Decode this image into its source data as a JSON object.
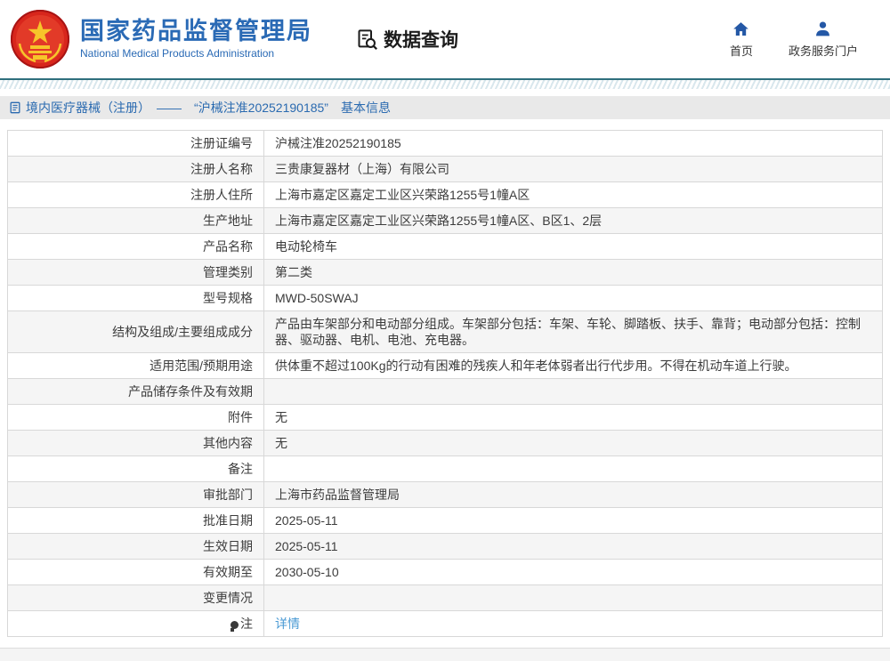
{
  "header": {
    "site_title": "国家药品监督管理局",
    "site_subtitle": "National Medical Products Administration",
    "section_title": "数据查询",
    "nav": [
      {
        "label": "首页",
        "icon": "home-icon"
      },
      {
        "label": "政务服务门户",
        "icon": "user-icon"
      }
    ]
  },
  "breadcrumb": {
    "text": "境内医疗器械（注册）　——　“沪械注准20252190185”　基本信息"
  },
  "table": {
    "rows": [
      {
        "label": "注册证编号",
        "value": "沪械注准20252190185"
      },
      {
        "label": "注册人名称",
        "value": "三贵康复器材（上海）有限公司"
      },
      {
        "label": "注册人住所",
        "value": "上海市嘉定区嘉定工业区兴荣路1255号1幢A区"
      },
      {
        "label": "生产地址",
        "value": "上海市嘉定区嘉定工业区兴荣路1255号1幢A区、B区1、2层"
      },
      {
        "label": "产品名称",
        "value": "电动轮椅车"
      },
      {
        "label": "管理类别",
        "value": "第二类"
      },
      {
        "label": "型号规格",
        "value": "MWD-50SWAJ"
      },
      {
        "label": "结构及组成/主要组成成分",
        "value": "产品由车架部分和电动部分组成。车架部分包括：车架、车轮、脚踏板、扶手、靠背；电动部分包括：控制器、驱动器、电机、电池、充电器。"
      },
      {
        "label": "适用范围/预期用途",
        "value": "供体重不超过100Kg的行动有困难的残疾人和年老体弱者出行代步用。不得在机动车道上行驶。"
      },
      {
        "label": "产品储存条件及有效期",
        "value": ""
      },
      {
        "label": "附件",
        "value": "无"
      },
      {
        "label": "其他内容",
        "value": "无"
      },
      {
        "label": "备注",
        "value": ""
      },
      {
        "label": "审批部门",
        "value": "上海市药品监督管理局"
      },
      {
        "label": "批准日期",
        "value": "2025-05-11"
      },
      {
        "label": "生效日期",
        "value": "2025-05-11"
      },
      {
        "label": "有效期至",
        "value": "2030-05-10"
      },
      {
        "label": "变更情况",
        "value": ""
      },
      {
        "label": "注",
        "label_icon": "bulb-icon",
        "value": "详情",
        "link": true
      }
    ]
  },
  "colors": {
    "accent_blue": "#2a6ab5",
    "nav_icon_blue": "#2458a6",
    "teal_divider": "#2f6f7d",
    "breadcrumb_bg": "#e9e9e9",
    "row_alt_bg": "#f5f5f5",
    "link_blue": "#4a9ad4",
    "emblem_red": "#d8261c",
    "emblem_gold": "#f7c52a"
  }
}
